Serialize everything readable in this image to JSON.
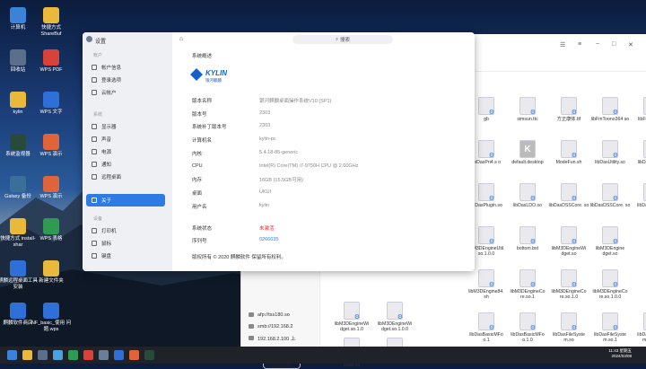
{
  "desktop": {
    "icons": [
      {
        "label": "计算机",
        "color": "#3b83d8"
      },
      {
        "label": "快捷方式 ShareBuf",
        "color": "#e8b93a"
      },
      {
        "label": "回收站",
        "color": "#5c6f8a"
      },
      {
        "label": "WPS PDF",
        "color": "#d9423a"
      },
      {
        "label": "kylin",
        "color": "#e8b93a"
      },
      {
        "label": "WPS 文字",
        "color": "#2e6fd8"
      },
      {
        "label": "系统监视器",
        "color": "#274a3a"
      },
      {
        "label": "WPS 演示",
        "color": "#e0643a"
      },
      {
        "label": "Galaxy 备份",
        "color": "#3a6f9a"
      },
      {
        "label": "WPS 演示",
        "color": "#e0643a"
      },
      {
        "label": "快捷方式 install-shar",
        "color": "#e8b93a"
      },
      {
        "label": "WPS 表格",
        "color": "#2f9a52"
      },
      {
        "label": "麒麟远程桌面工具安装",
        "color": "#2e6fd8"
      },
      {
        "label": "新建文件夹",
        "color": "#e8b93a"
      },
      {
        "label": "麒麟软件商店",
        "color": "#2e6fd8"
      },
      {
        "label": "NF_basic_使用 问题.wps",
        "color": "#2e6fd8"
      }
    ]
  },
  "file_manager": {
    "sidebar": [
      "afp://tss180.so",
      "smb://192.168.2",
      "192.168.2.100 上",
      "ShareBuf"
    ],
    "add_button": "所有数据",
    "files": [
      {
        "name": "gb",
        "row": 0,
        "col": 0
      },
      {
        "name": "simsun.ttc",
        "row": 0,
        "col": 1
      },
      {
        "name": "方正康体.ttf",
        "row": 0,
        "col": 2
      },
      {
        "name": "libFmToono364 so",
        "row": 0,
        "col": 3
      },
      {
        "name": "libFmToono3",
        "row": 0,
        "col": 4
      },
      {
        "name": "libDasPri4.s o",
        "row": 1,
        "col": 0
      },
      {
        "name": "default.desktop",
        "row": 1,
        "col": 1
      },
      {
        "name": "ModeFun.sh",
        "row": 1,
        "col": 2
      },
      {
        "name": "libDasUtility.so",
        "row": 1,
        "col": 3
      },
      {
        "name": "libDasUtility.s",
        "row": 1,
        "col": 4
      },
      {
        "name": "libDasPlugin.so",
        "row": 2,
        "col": 0
      },
      {
        "name": "libDasLDO.so",
        "row": 2,
        "col": 1
      },
      {
        "name": "libDasDSSCore. so",
        "row": 2,
        "col": 2
      },
      {
        "name": "libDasDSSCore. so",
        "row": 2,
        "col": 3
      },
      {
        "name": "libDasDSSCo",
        "row": 2,
        "col": 4
      },
      {
        "name": "libM3DEngineUtil. so.1.0.0",
        "row": 3,
        "col": 0
      },
      {
        "name": "bottom.bst",
        "row": 3,
        "col": 1
      },
      {
        "name": "libM3DEngineWi dget.so",
        "row": 3,
        "col": 2
      },
      {
        "name": "libM3DEngine dget.so",
        "row": 3,
        "col": 3
      },
      {
        "name": "libM3DEngine84. sh",
        "row": 4,
        "col": 0
      },
      {
        "name": "libM3DEngineCo re.so.1",
        "row": 4,
        "col": 1
      },
      {
        "name": "libM3DEngineCo re.so.1.0",
        "row": 4,
        "col": 2
      },
      {
        "name": "libM3DEngineCo re.so.1.0.0",
        "row": 4,
        "col": 3
      },
      {
        "name": "libDasBasicMFo o.1",
        "row": 5,
        "col": 0
      },
      {
        "name": "libDasBasicMFo o.1.0",
        "row": 5,
        "col": 1
      },
      {
        "name": "libDasFileSyste m.so",
        "row": 5,
        "col": 2
      },
      {
        "name": "libDasFileSyste m.so.1",
        "row": 5,
        "col": 3
      },
      {
        "name": "libDasFileSys m.so.1.0",
        "row": 5,
        "col": 4
      }
    ],
    "left_files": [
      {
        "name": "libM3DEngineWi dget.so.1.0",
        "row": 0
      },
      {
        "name": "libM3DEngineWi dget.so.1.0.0",
        "row": 1
      },
      {
        "name": "libDasCommon Math.so",
        "row": 2
      },
      {
        "name": "libDasBasicMF.s o",
        "row": 3
      }
    ]
  },
  "settings": {
    "title": "设置",
    "search": "搜索",
    "sections": {
      "account": "帐户",
      "system": "系统",
      "device": "设备"
    },
    "nav": [
      {
        "label": "帐户信息",
        "group": "account"
      },
      {
        "label": "登录选项",
        "group": "account"
      },
      {
        "label": "云帐户",
        "group": "account"
      },
      {
        "label": "显示器",
        "group": "system"
      },
      {
        "label": "声音",
        "group": "system"
      },
      {
        "label": "电源",
        "group": "system"
      },
      {
        "label": "通知",
        "group": "system"
      },
      {
        "label": "远程桌面",
        "group": "system"
      },
      {
        "label": "关于",
        "group": "system",
        "active": true
      },
      {
        "label": "打印机",
        "group": "device"
      },
      {
        "label": "鼠标",
        "group": "device"
      },
      {
        "label": "键盘",
        "group": "device"
      }
    ],
    "header": "系统概述",
    "logo": {
      "name": "KYLIN",
      "sub": "银河麒麟"
    },
    "info": [
      {
        "label": "版本名称",
        "value": "银河麒麟桌面操作系统V10 (SP1)"
      },
      {
        "label": "版本号",
        "value": "2303"
      },
      {
        "label": "系统补丁版本号",
        "value": "2303"
      },
      {
        "label": "计算机名",
        "value": "kylin-pc"
      },
      {
        "label": "内核",
        "value": "5.4.18-85-generic"
      },
      {
        "label": "CPU",
        "value": "Intel(R) Core(TM) i7-9750H CPU @ 2.60GHz"
      },
      {
        "label": "内存",
        "value": "16GB (15.5GB可用)"
      },
      {
        "label": "桌面",
        "value": "UKUI"
      },
      {
        "label": "用户名",
        "value": "kylin"
      }
    ],
    "status": [
      {
        "label": "系统状态",
        "value": "未激活",
        "style": "red"
      },
      {
        "label": "序列号",
        "value": "0266035",
        "style": "blue"
      }
    ],
    "activate_button": "激活",
    "copyright": "版权所有 © 2020 麒麟软件 保留所有权利。"
  },
  "taskbar": {
    "time": "11:43 星期五",
    "date": "2024/03/08",
    "apps": [
      "#3b83d8",
      "#e8b93a",
      "#5c6f8a",
      "#4aa3e0",
      "#2f9a52",
      "#d9423a",
      "#6a7e9a",
      "#2e6fd8",
      "#e0643a",
      "#274a3a"
    ]
  }
}
